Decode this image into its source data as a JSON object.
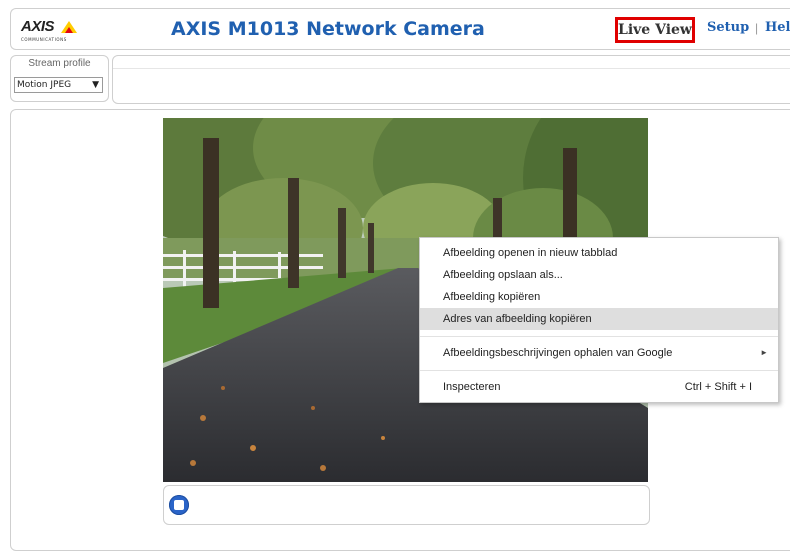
{
  "header": {
    "logo_text": "AXIS",
    "logo_sub": "COMMUNICATIONS",
    "title": "AXIS M1013 Network Camera",
    "nav": {
      "live_view": "Live View",
      "setup": "Setup",
      "separator": "|",
      "help": "Help"
    }
  },
  "stream_profile": {
    "label": "Stream profile",
    "value": "Motion JPEG",
    "arrow": "▼"
  },
  "video": {
    "controls": {
      "stop_icon": "stop-icon"
    }
  },
  "context_menu": {
    "items": [
      {
        "label": "Afbeelding openen in nieuw tabblad"
      },
      {
        "label": "Afbeelding opslaan als..."
      },
      {
        "label": "Afbeelding kopiëren"
      },
      {
        "label": "Adres van afbeelding kopiëren",
        "highlighted": true
      },
      {
        "label": "Afbeeldingsbeschrijvingen ophalen van Google",
        "submenu": "►"
      },
      {
        "label": "Inspecteren",
        "shortcut": "Ctrl + Shift + I"
      }
    ]
  },
  "colors": {
    "accent": "#2060b0",
    "live_view_border": "#e00000",
    "logo_yellow": "#ffcc00",
    "logo_red": "#e30613"
  }
}
